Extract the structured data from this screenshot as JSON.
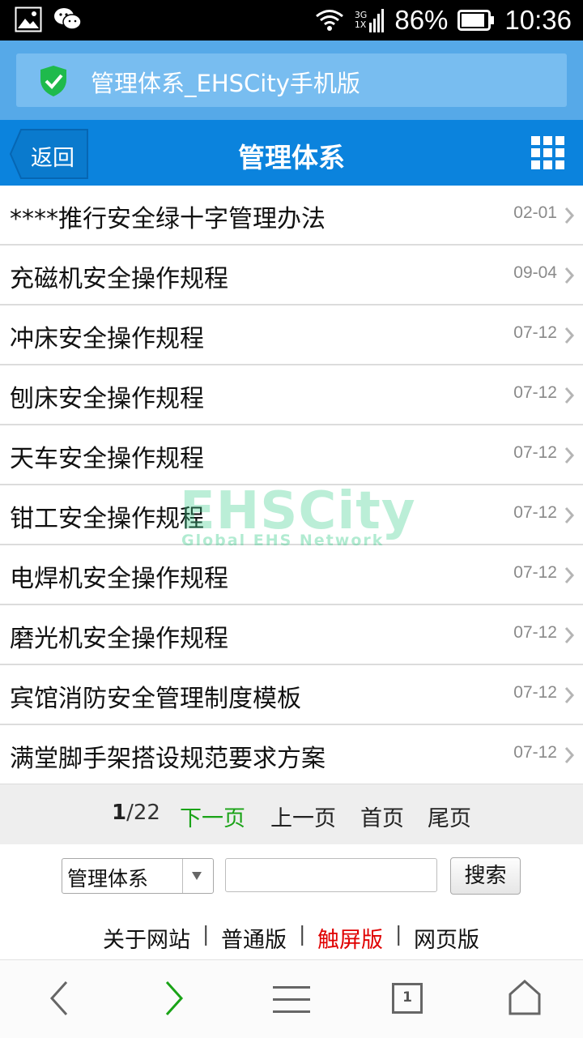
{
  "status_bar": {
    "network_top": "3G",
    "network_bottom": "1X",
    "battery": "86%",
    "time": "10:36"
  },
  "browser": {
    "page_title": "管理体系_EHSCity手机版"
  },
  "header": {
    "back_label": "返回",
    "title": "管理体系"
  },
  "list": [
    {
      "title": "****推行安全绿十字管理办法",
      "date": "02-01"
    },
    {
      "title": "充磁机安全操作规程",
      "date": "09-04"
    },
    {
      "title": "冲床安全操作规程",
      "date": "07-12"
    },
    {
      "title": "刨床安全操作规程",
      "date": "07-12"
    },
    {
      "title": "天车安全操作规程",
      "date": "07-12"
    },
    {
      "title": "钳工安全操作规程",
      "date": "07-12"
    },
    {
      "title": "电焊机安全操作规程",
      "date": "07-12"
    },
    {
      "title": "磨光机安全操作规程",
      "date": "07-12"
    },
    {
      "title": "宾馆消防安全管理制度模板",
      "date": "07-12"
    },
    {
      "title": "满堂脚手架搭设规范要求方案",
      "date": "07-12"
    }
  ],
  "watermark": {
    "brand": "EHSCity",
    "tagline": "Global EHS Network"
  },
  "pagination": {
    "current": "1",
    "total": "/22",
    "next": "下一页",
    "prev": "上一页",
    "first": "首页",
    "last": "尾页"
  },
  "search": {
    "category": "管理体系",
    "input_value": "",
    "button": "搜索"
  },
  "footer": {
    "about": "关于网站",
    "normal": "普通版",
    "touch": "触屏版",
    "web": "网页版",
    "separator": "|"
  },
  "bottom_nav": {
    "tab_count": "1"
  },
  "colors": {
    "header_blue": "#0b83dd",
    "browser_bar": "#56a9e8",
    "shield_green": "#1fba4c",
    "next_green": "#1aa317",
    "active_red": "#e00000",
    "watermark_green": "#3fcf8e"
  }
}
